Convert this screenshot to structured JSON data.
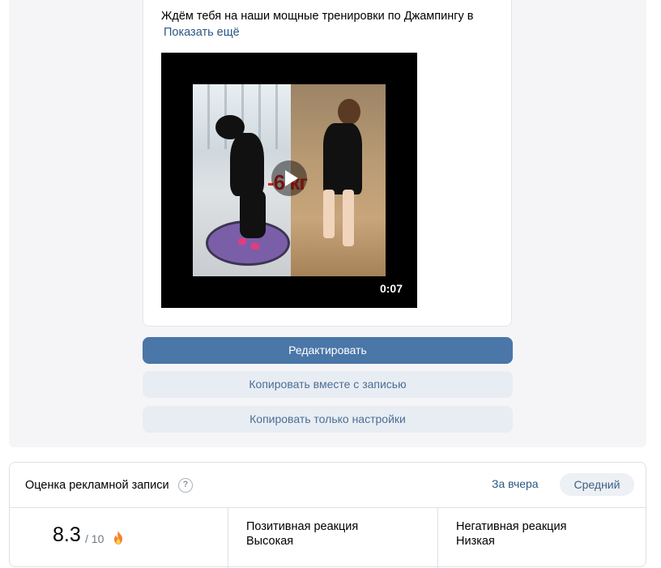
{
  "post": {
    "text": "Ждём тебя на наши мощные тренировки по Джампингу в",
    "show_more": "Показать ещё",
    "video": {
      "duration": "0:07",
      "watermark": "-6 кг"
    }
  },
  "actions": {
    "edit": "Редактировать",
    "copy_with_post": "Копировать вместе с записью",
    "copy_settings_only": "Копировать только настройки"
  },
  "rating": {
    "title": "Оценка рекламной записи",
    "help_icon": "?",
    "period_link": "За вчера",
    "period_selected": "Средний",
    "score": "8.3",
    "score_max": "/ 10",
    "positive_label": "Позитивная реакция",
    "positive_value": "Высокая",
    "negative_label": "Негативная реакция",
    "negative_value": "Низкая"
  },
  "colors": {
    "primary_button": "#4a76a8",
    "secondary_button": "#e8edf4",
    "link": "#2a5885"
  }
}
